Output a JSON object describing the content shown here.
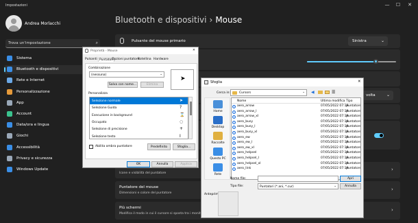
{
  "window": {
    "app_title": "Impostazioni",
    "controls": [
      "—",
      "☐",
      "✕"
    ]
  },
  "user": {
    "name": "Andrea Morlacchi"
  },
  "search": {
    "placeholder": "Trova un'impostazione",
    "icon": "search-icon"
  },
  "sidebar": {
    "items": [
      {
        "label": "Sistema",
        "icon": "system-icon",
        "color": "#3a8ee6",
        "active": false
      },
      {
        "label": "Bluetooth e dispositivi",
        "icon": "bluetooth-devices-icon",
        "color": "#3a8ee6",
        "active": true
      },
      {
        "label": "Rete e Internet",
        "icon": "network-icon",
        "color": "#6ba8e6",
        "active": false
      },
      {
        "label": "Personalizzazione",
        "icon": "paint-brush-icon",
        "color": "#e69a3a",
        "active": false
      },
      {
        "label": "App",
        "icon": "apps-icon",
        "color": "#9aa8b8",
        "active": false
      },
      {
        "label": "Account",
        "icon": "account-icon",
        "color": "#3ac28e",
        "active": false
      },
      {
        "label": "Data/ora e lingua",
        "icon": "globe-clock-icon",
        "color": "#3a8ee6",
        "active": false
      },
      {
        "label": "Giochi",
        "icon": "gamepad-icon",
        "color": "#9aa8b8",
        "active": false
      },
      {
        "label": "Accessibilità",
        "icon": "accessibility-icon",
        "color": "#3a8ee6",
        "active": false
      },
      {
        "label": "Privacy e sicurezza",
        "icon": "shield-icon",
        "color": "#9aa8b8",
        "active": false
      },
      {
        "label": "Windows Update",
        "icon": "update-icon",
        "color": "#3a8ee6",
        "active": false
      }
    ]
  },
  "header": {
    "breadcrumb_parent": "Bluetooth e dispositivi",
    "separator": "›",
    "title": "Mouse"
  },
  "settings": {
    "primary_button": {
      "label": "Pulsante del mouse primario",
      "value": "Sinistra"
    },
    "pointer_speed_level": 0.78,
    "scroll_value": "volta",
    "toggle_on": true,
    "row_partial_sub": "Icone e visibilità del puntatore",
    "pointer_card": {
      "title": "Puntatore del mouse",
      "sub": "Dimensioni e colore del puntatore"
    },
    "more_screens": {
      "title": "Più schermi",
      "sub": "Modifica il modo in cui il cursore si sposta tra i monitor"
    }
  },
  "properties_dialog": {
    "title": "Proprietà - Mouse",
    "tabs": [
      "Pulsanti",
      "Puntatori",
      "Opzioni puntatore",
      "Rotellina",
      "Hardware"
    ],
    "active_tab": 1,
    "scheme_group": "Combinazione",
    "scheme_value": "(nessuna)",
    "save_label": "Salva con nome...",
    "delete_label": "Elimina",
    "customize_label": "Personalizza",
    "pointers": [
      {
        "label": "Selezione normale",
        "selected": true
      },
      {
        "label": "Selezione Guida",
        "selected": false
      },
      {
        "label": "Esecuzione in background",
        "selected": false
      },
      {
        "label": "Occupato",
        "selected": false
      },
      {
        "label": "Selezione di precisione",
        "selected": false
      },
      {
        "label": "Selezione testo",
        "selected": false
      }
    ],
    "shadow_label": "Abilita ombra puntatore",
    "default_label": "Predefinito",
    "browse_label": "Sfoglia...",
    "ok_label": "OK",
    "cancel_label": "Annulla",
    "apply_label": "Applica"
  },
  "file_dialog": {
    "title": "Sfoglia",
    "lookin_label": "Cerca in:",
    "folder": "Cursors",
    "columns": [
      "Nome",
      "Ultima modifica",
      "Tipo"
    ],
    "places": [
      {
        "label": "Home",
        "icon": "home-folder-icon",
        "color": "#4a90d9"
      },
      {
        "label": "Desktop",
        "icon": "desktop-icon",
        "color": "#2a6fc9"
      },
      {
        "label": "Raccolte",
        "icon": "libraries-icon",
        "color": "#e0b040"
      },
      {
        "label": "Questo PC",
        "icon": "computer-icon",
        "color": "#3a8ee6"
      },
      {
        "label": "Rete",
        "icon": "network-icon",
        "color": "#3a8ee6"
      }
    ],
    "files": [
      {
        "name": "aero_arrow",
        "date": "07/05/2022 07:19",
        "type": "puntatore"
      },
      {
        "name": "aero_arrow_l",
        "date": "07/05/2022 07:19",
        "type": "puntatore"
      },
      {
        "name": "aero_arrow_xl",
        "date": "07/05/2022 07:19",
        "type": "puntatore"
      },
      {
        "name": "aero_busy",
        "date": "07/05/2022 07:19",
        "type": "puntatore"
      },
      {
        "name": "aero_busy_l",
        "date": "07/05/2022 07:19",
        "type": "puntatore"
      },
      {
        "name": "aero_busy_xl",
        "date": "07/05/2022 07:19",
        "type": "puntatore"
      },
      {
        "name": "aero_ew",
        "date": "07/05/2022 07:19",
        "type": "puntatore"
      },
      {
        "name": "aero_ew_l",
        "date": "07/05/2022 07:19",
        "type": "puntatore"
      },
      {
        "name": "aero_ew_xl",
        "date": "07/05/2022 07:19",
        "type": "puntatore"
      },
      {
        "name": "aero_helpsel",
        "date": "07/05/2022 07:19",
        "type": "puntatore"
      },
      {
        "name": "aero_helpsel_l",
        "date": "07/05/2022 07:19",
        "type": "puntatore"
      },
      {
        "name": "aero_helpsel_xl",
        "date": "07/05/2022 07:19",
        "type": "puntatore"
      },
      {
        "name": "aero_link",
        "date": "07/05/2022 07:19",
        "type": "puntatore"
      }
    ],
    "filename_label": "Nome file:",
    "filename_value": "",
    "filetype_label": "Tipo file:",
    "filetype_value": "Puntatori (*.ani, *.cur)",
    "open_label": "Apri",
    "cancel_label": "Annulla",
    "preview_label": "Anteprima:"
  }
}
